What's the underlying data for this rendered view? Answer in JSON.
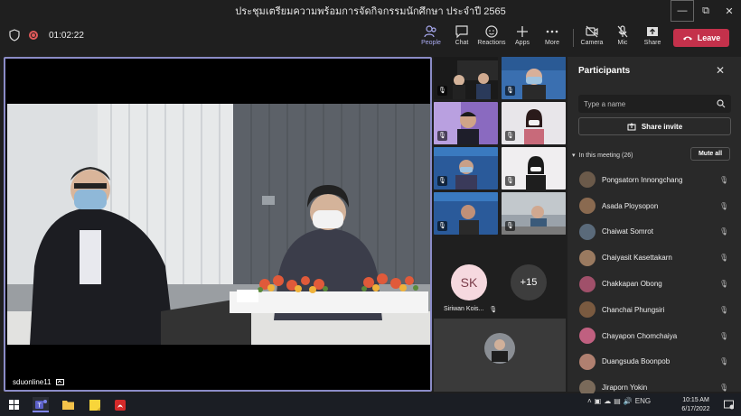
{
  "window": {
    "title": "ประชุมเตรียมความพร้อมการจัดกิจกรรมนักศึกษา ประจำปี 2565",
    "controls": {
      "minimize": "—",
      "restore": "⧉",
      "close": "✕"
    }
  },
  "toolbar": {
    "timer": "01:02:22",
    "buttons": {
      "people": "People",
      "chat": "Chat",
      "reactions": "Reactions",
      "apps": "Apps",
      "more": "More",
      "camera": "Camera",
      "mic": "Mic",
      "share": "Share"
    },
    "leave_label": "Leave",
    "colors": {
      "leave": "#c4314b",
      "active": "#a9aaf0"
    }
  },
  "stage": {
    "participant_name": "sduonline11",
    "icons": [
      "video-feed"
    ]
  },
  "gallery": {
    "sk_initials": "SK",
    "overflow_count": "+15",
    "sk_name": "Siriwan Kois..."
  },
  "panel": {
    "title": "Participants",
    "search_placeholder": "Type a name",
    "share_invite": "Share invite",
    "in_meeting": "In this meeting (26)",
    "mute_all": "Mute all",
    "participants": [
      {
        "name": "Pongsatorn Innongchang",
        "avatar_color": "#6b5a4a"
      },
      {
        "name": "Asada Ploysopon",
        "avatar_color": "#8a6a50"
      },
      {
        "name": "Chaiwat Somrot",
        "avatar_color": "#5a6a7a"
      },
      {
        "name": "Chaiyasit Kasettakarn",
        "avatar_color": "#9a7a60"
      },
      {
        "name": "Chakkapan Obong",
        "avatar_color": "#a0506a"
      },
      {
        "name": "Chanchai Phungsiri",
        "avatar_color": "#7a5a40"
      },
      {
        "name": "Chayapon Chomchaiya",
        "avatar_color": "#c06080"
      },
      {
        "name": "Duangsuda Boonpob",
        "avatar_color": "#b08070"
      },
      {
        "name": "Jiraporn Yokin",
        "avatar_color": "#7a6a5a"
      }
    ]
  },
  "taskbar": {
    "language": "ENG",
    "time": "10:15 AM",
    "date": "6/17/2022"
  }
}
